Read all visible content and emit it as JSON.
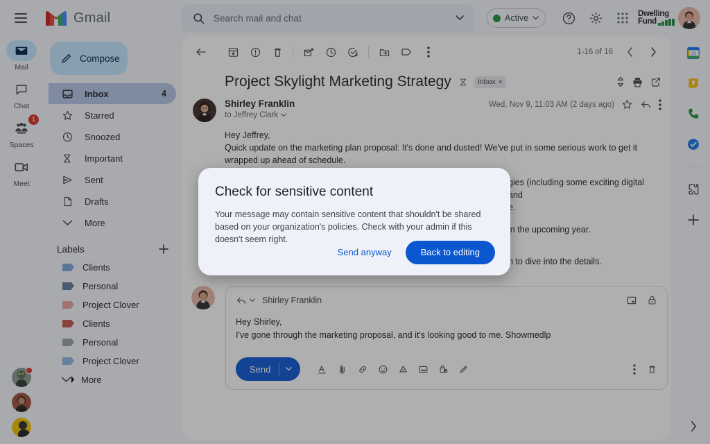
{
  "app": {
    "brand_name": "Gmail",
    "menu_icon": "hamburger-icon"
  },
  "search": {
    "placeholder": "Search mail and chat",
    "value": ""
  },
  "header": {
    "status_label": "Active",
    "status_color": "#1e8e3e",
    "help_icon": "help-icon",
    "settings_icon": "gear-icon",
    "apps_icon": "apps-grid-icon",
    "logo_line1": "Dwelling",
    "logo_line2": "Fund"
  },
  "rail": {
    "items": [
      {
        "label": "Mail",
        "icon": "mail-icon",
        "active": true,
        "badge": ""
      },
      {
        "label": "Chat",
        "icon": "chat-icon",
        "active": false,
        "badge": ""
      },
      {
        "label": "Spaces",
        "icon": "spaces-icon",
        "active": false,
        "badge": "1"
      },
      {
        "label": "Meet",
        "icon": "meet-icon",
        "active": false,
        "badge": ""
      }
    ]
  },
  "sidebar": {
    "compose_label": "Compose",
    "nav": [
      {
        "label": "Inbox",
        "icon": "inbox-icon",
        "count": "4",
        "selected": true
      },
      {
        "label": "Starred",
        "icon": "star-icon",
        "count": "",
        "selected": false
      },
      {
        "label": "Snoozed",
        "icon": "clock-icon",
        "count": "",
        "selected": false
      },
      {
        "label": "Important",
        "icon": "important-icon",
        "count": "",
        "selected": false
      },
      {
        "label": "Sent",
        "icon": "send-icon",
        "count": "",
        "selected": false
      },
      {
        "label": "Drafts",
        "icon": "draft-icon",
        "count": "",
        "selected": false
      },
      {
        "label": "More",
        "icon": "chevron-down-icon",
        "count": "",
        "selected": false
      }
    ],
    "labels_title": "Labels",
    "add_label_icon": "plus-icon",
    "labels": [
      {
        "label": "Clients",
        "color": "#7ba7d7"
      },
      {
        "label": "Personal",
        "color": "#5f7a9c"
      },
      {
        "label": "Project Clover",
        "color": "#e8a49c"
      },
      {
        "label": "Clients",
        "color": "#c0564a"
      },
      {
        "label": "Personal",
        "color": "#9aa0a6"
      },
      {
        "label": "Project Clover",
        "color": "#8fb4de"
      },
      {
        "label": "More",
        "color": ""
      }
    ],
    "labels_more": "More"
  },
  "toolbar": {
    "back_icon": "arrow-back-icon",
    "icons": [
      "archive-icon",
      "report-spam-icon",
      "delete-icon",
      "mark-unread-icon",
      "snooze-icon",
      "add-to-tasks-icon",
      "move-to-icon",
      "label-icon",
      "more-options-icon"
    ],
    "pagination": "1-16 of 16",
    "prev_icon": "chevron-left-icon",
    "next_icon": "chevron-right-icon"
  },
  "thread": {
    "subject": "Project Skylight Marketing Strategy",
    "important_icon": "important-icon",
    "label_chip": "Inbox",
    "label_chip_close": "×",
    "expand_icon": "expand-collapse-icon",
    "print_icon": "print-icon",
    "popout_icon": "open-in-new-icon"
  },
  "message": {
    "sender": "Shirley Franklin",
    "recipient": "to Jeffrey Clark",
    "date": "Wed, Nov 9, 11:03 AM (2 days ago)",
    "star_icon": "star-icon",
    "reply_icon": "reply-icon",
    "more_icon": "more-options-icon",
    "body": [
      "Hey Jeffrey,",
      "Quick update on the marketing plan proposal: It's done and dusted! We've put in some serious work to get it wrapped up ahead of schedule.",
      "gies (including some exciting digital and",
      "e.",
      "in the upcoming year.",
      "n to dive into the details."
    ]
  },
  "reply": {
    "mode_icon": "reply-icon",
    "caret_icon": "chevron-down-icon",
    "recipient": "Shirley Franklin",
    "minimize_icon": "minimize-icon",
    "confidential_icon": "lock-icon",
    "body_line1": "Hey Shirley,",
    "body_line2": "I've gone through the marketing proposal, and it's looking good to me. Showmedlp",
    "send_label": "Send",
    "send_caret_icon": "chevron-down-icon",
    "format_icons": [
      "text-format-icon",
      "attach-file-icon",
      "insert-link-icon",
      "insert-emoji-icon",
      "insert-drive-icon",
      "insert-photo-icon",
      "confidential-mode-icon",
      "signature-icon"
    ],
    "more_icon": "more-options-icon",
    "discard_icon": "delete-draft-icon"
  },
  "dialog": {
    "title": "Check for sensitive content",
    "body": "Your message may contain sensitive content that shouldn't be shared based on your organization's policies. Check with your admin if this doesn't seem right.",
    "secondary_button": "Send anyway",
    "primary_button": "Back to editing",
    "primary_color": "#0b57d0"
  },
  "right_rail": {
    "items": [
      {
        "icon": "calendar-icon",
        "label": "31"
      },
      {
        "icon": "keep-icon",
        "label": ""
      },
      {
        "icon": "contacts-icon",
        "label": ""
      },
      {
        "icon": "tasks-icon",
        "label": ""
      }
    ],
    "addons_icon": "puzzle-addons-icon",
    "add_icon": "plus-icon",
    "expand_icon": "chevron-right-icon"
  }
}
